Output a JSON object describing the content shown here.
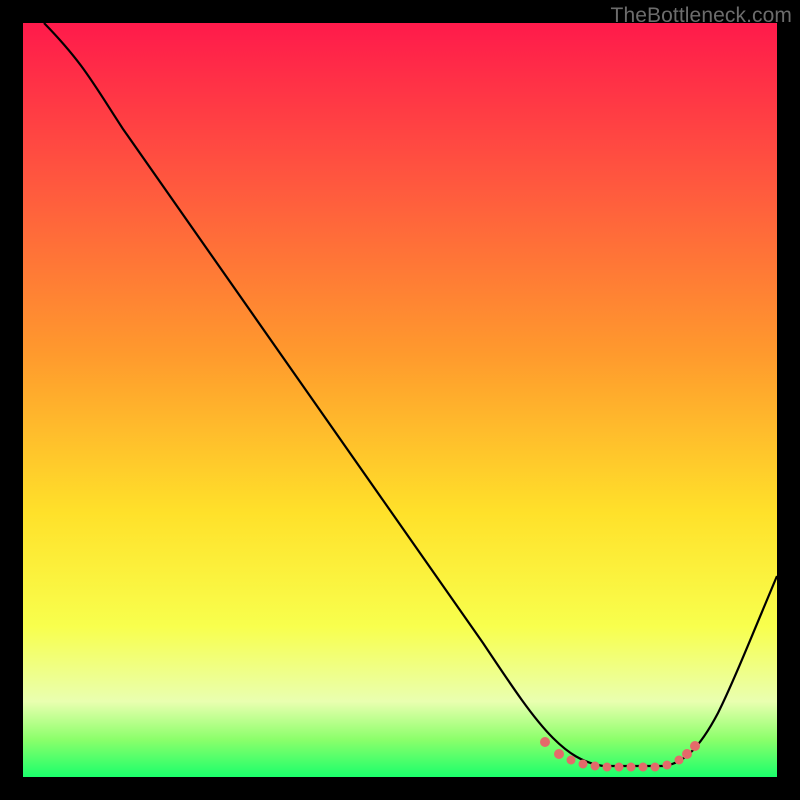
{
  "watermark": "TheBottleneck.com",
  "colors": {
    "stroke_main": "#000000",
    "stroke_accent": "#e46a6a",
    "gradient_top": "#ff1a4b",
    "gradient_bottom": "#1aff6b"
  },
  "chart_data": {
    "type": "line",
    "title": "",
    "xlabel": "",
    "ylabel": "",
    "xlim": [
      0,
      100
    ],
    "ylim": [
      0,
      100
    ],
    "grid": false,
    "legend": false,
    "series": [
      {
        "name": "curve",
        "x": [
          3,
          10,
          20,
          30,
          40,
          50,
          60,
          65,
          70,
          75,
          80,
          85,
          90,
          95,
          100
        ],
        "values": [
          100,
          93,
          82,
          69,
          57,
          44,
          31,
          19,
          10,
          3,
          0,
          0,
          2,
          11,
          26
        ]
      }
    ],
    "annotations": [
      {
        "name": "flat-min-accent",
        "x_start": 67,
        "x_end": 88,
        "y": 0
      }
    ]
  }
}
